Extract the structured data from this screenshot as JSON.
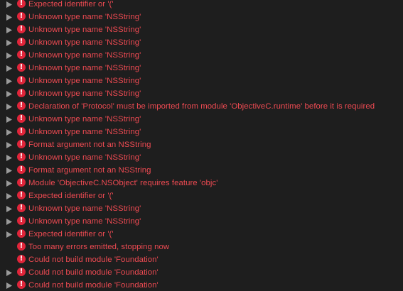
{
  "colors": {
    "background": "#1e1e1e",
    "error_text": "#ee4a52",
    "error_icon": "#e0253a",
    "disclosure": "#9a9a9a"
  },
  "icons": {
    "disclosure": "disclosure-triangle-icon",
    "error": "error-badge-icon",
    "error_glyph": "!"
  },
  "issues": [
    {
      "message": "Expected identifier or '('",
      "expandable": true
    },
    {
      "message": "Unknown type name 'NSString'",
      "expandable": true
    },
    {
      "message": "Unknown type name 'NSString'",
      "expandable": true
    },
    {
      "message": "Unknown type name 'NSString'",
      "expandable": true
    },
    {
      "message": "Unknown type name 'NSString'",
      "expandable": true
    },
    {
      "message": "Unknown type name 'NSString'",
      "expandable": true
    },
    {
      "message": "Unknown type name 'NSString'",
      "expandable": true
    },
    {
      "message": "Unknown type name 'NSString'",
      "expandable": true
    },
    {
      "message": "Declaration of 'Protocol' must be imported from module 'ObjectiveC.runtime' before it is required",
      "expandable": true
    },
    {
      "message": "Unknown type name 'NSString'",
      "expandable": true
    },
    {
      "message": "Unknown type name 'NSString'",
      "expandable": true
    },
    {
      "message": "Format argument not an NSString",
      "expandable": true
    },
    {
      "message": "Unknown type name 'NSString'",
      "expandable": true
    },
    {
      "message": "Format argument not an NSString",
      "expandable": true
    },
    {
      "message": "Module 'ObjectiveC.NSObject' requires feature 'objc'",
      "expandable": true
    },
    {
      "message": "Expected identifier or '('",
      "expandable": true
    },
    {
      "message": "Unknown type name 'NSString'",
      "expandable": true
    },
    {
      "message": "Unknown type name 'NSString'",
      "expandable": true
    },
    {
      "message": "Expected identifier or '('",
      "expandable": true
    },
    {
      "message": "Too many errors emitted, stopping now",
      "expandable": false
    },
    {
      "message": "Could not build module 'Foundation'",
      "expandable": false
    },
    {
      "message": "Could not build module 'Foundation'",
      "expandable": true
    },
    {
      "message": "Could not build module 'Foundation'",
      "expandable": true
    }
  ]
}
